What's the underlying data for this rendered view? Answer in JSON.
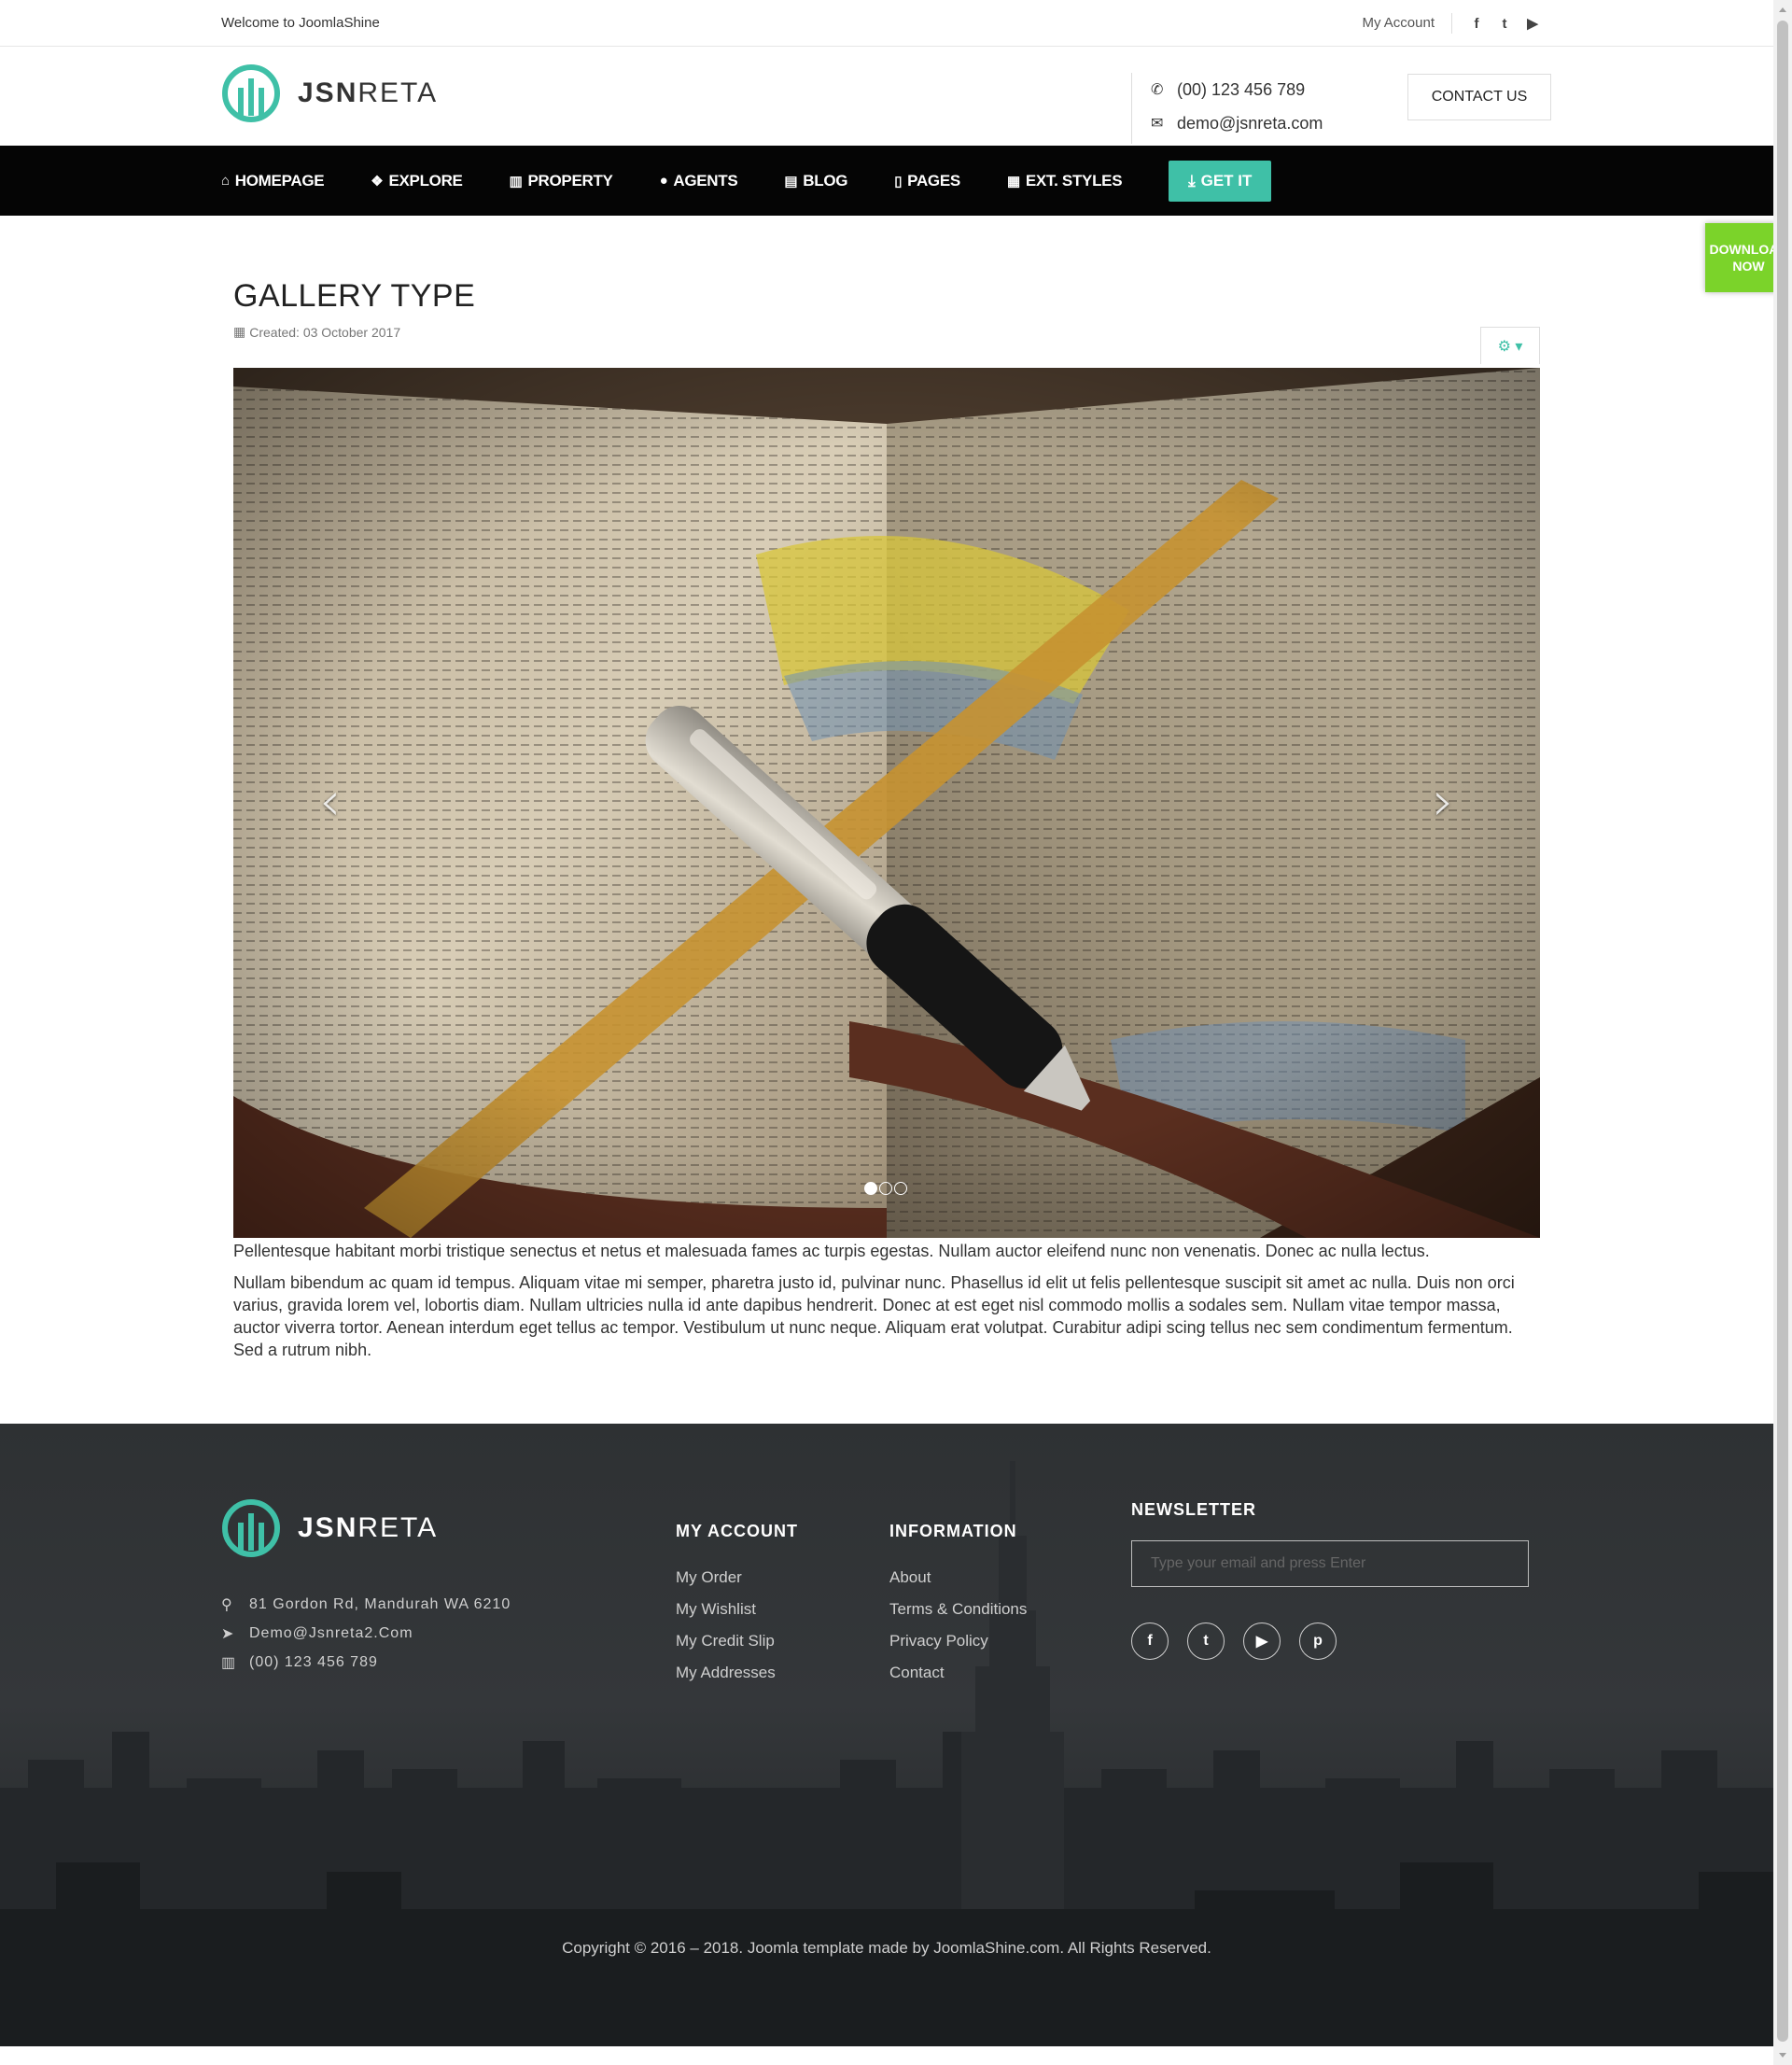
{
  "topbar": {
    "welcome": "Welcome to JoomlaShine",
    "account": "My Account",
    "social_icons": [
      "facebook-icon",
      "twitter-icon",
      "youtube-icon"
    ],
    "social_glyphs": [
      "f",
      "t",
      "▶"
    ]
  },
  "header": {
    "logo_bold": "JSN",
    "logo_light": "RETA",
    "phone": "(00) 123 456 789",
    "email": "demo@jsnreta.com",
    "contact_button": "CONTACT US"
  },
  "nav": {
    "items": [
      {
        "label": "HOMEPAGE",
        "icon": "home-icon",
        "glyph": "⌂"
      },
      {
        "label": "EXPLORE",
        "icon": "cubes-icon",
        "glyph": "❖"
      },
      {
        "label": "PROPERTY",
        "icon": "building-icon",
        "glyph": "▥"
      },
      {
        "label": "AGENTS",
        "icon": "user-icon",
        "glyph": "●"
      },
      {
        "label": "BLOG",
        "icon": "newspaper-icon",
        "glyph": "▤"
      },
      {
        "label": "PAGES",
        "icon": "file-icon",
        "glyph": "▯"
      },
      {
        "label": "EXT. STYLES",
        "icon": "qrcode-icon",
        "glyph": "▦"
      }
    ],
    "get_it": "GET IT",
    "get_it_icon": "⤓"
  },
  "download_now": "DOWNLOAD NOW",
  "article": {
    "title": "GALLERY TYPE",
    "created": "Created: 03 October 2017",
    "tools_icon": "⚙ ▾",
    "carousel": {
      "prev": "‹",
      "next": "›",
      "slide_count": 3,
      "active_index": 0
    },
    "paragraphs": [
      "Pellentesque habitant morbi tristique senectus et netus et malesuada fames ac turpis egestas. Nullam auctor eleifend nunc non venenatis. Donec ac nulla lectus.",
      "Nullam bibendum ac quam id tempus. Aliquam vitae mi semper, pharetra justo id, pulvinar nunc. Phasellus id elit ut felis pellentesque suscipit sit amet ac nulla. Duis non orci varius, gravida lorem vel, lobortis diam. Nullam ultricies nulla id ante dapibus hendrerit. Donec at est eget nisl commodo mollis a sodales sem. Nullam vitae tempor massa, auctor viverra tortor. Aenean interdum eget tellus ac tempor. Vestibulum ut nunc neque. Aliquam erat volutpat. Curabitur adipi scing tellus nec sem condimentum fermentum. Sed a rutrum nibh."
    ]
  },
  "footer": {
    "logo_bold": "JSN",
    "logo_light": "RETA",
    "address": "81 Gordon Rd, Mandurah WA 6210",
    "email": "Demo@Jsnreta2.Com",
    "phone": "(00) 123 456 789",
    "my_account": {
      "title": "MY ACCOUNT",
      "links": [
        "My Order",
        "My Wishlist",
        "My Credit Slip",
        "My Addresses"
      ]
    },
    "information": {
      "title": "INFORMATION",
      "links": [
        "About",
        "Terms & Conditions",
        "Privacy Policy",
        "Contact"
      ]
    },
    "newsletter": {
      "title": "NEWSLETTER",
      "placeholder": "Type your email and press Enter"
    },
    "social_icons": [
      "facebook-icon",
      "twitter-icon",
      "youtube-icon",
      "pinterest-icon"
    ],
    "social_glyphs": [
      "f",
      "t",
      "▶",
      "p"
    ],
    "copyright": "Copyright © 2016 – 2018. Joomla template made by JoomlaShine.com. All Rights Reserved."
  },
  "colors": {
    "accent": "#3fc0a7",
    "nav_bg": "#050505",
    "download_green": "#7bd32a"
  }
}
